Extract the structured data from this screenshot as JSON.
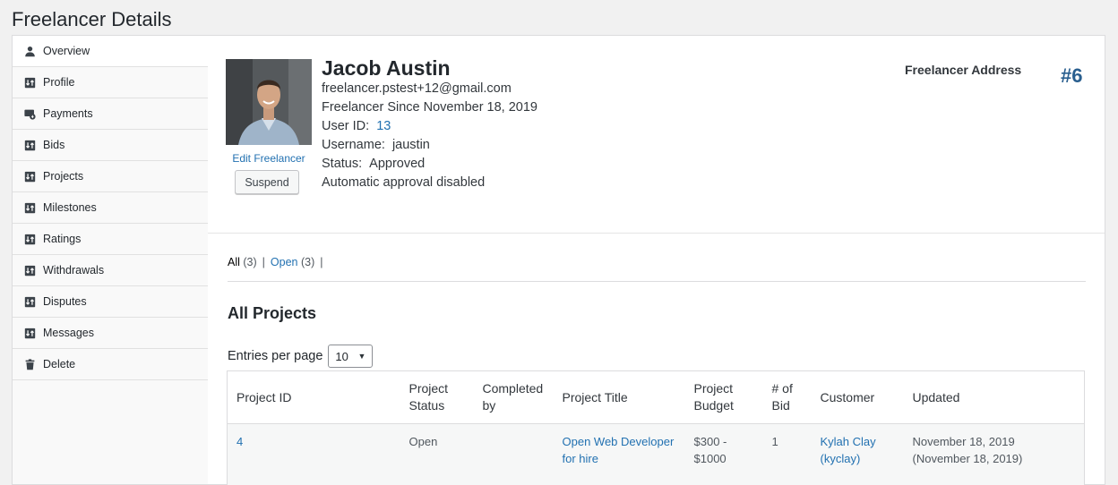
{
  "page": {
    "title": "Freelancer Details"
  },
  "sidebar": {
    "items": [
      {
        "label": "Overview",
        "icon": "user-icon"
      },
      {
        "label": "Profile",
        "icon": "sort-icon"
      },
      {
        "label": "Payments",
        "icon": "payments-icon"
      },
      {
        "label": "Bids",
        "icon": "sort-icon"
      },
      {
        "label": "Projects",
        "icon": "sort-icon"
      },
      {
        "label": "Milestones",
        "icon": "sort-icon"
      },
      {
        "label": "Ratings",
        "icon": "sort-icon"
      },
      {
        "label": "Withdrawals",
        "icon": "sort-icon"
      },
      {
        "label": "Disputes",
        "icon": "sort-icon"
      },
      {
        "label": "Messages",
        "icon": "sort-icon"
      },
      {
        "label": "Delete",
        "icon": "trash-icon"
      }
    ]
  },
  "profile": {
    "name": "Jacob Austin",
    "email": "freelancer.pstest+12@gmail.com",
    "since": "Freelancer Since November 18, 2019",
    "user_id_label": "User ID:",
    "user_id": "13",
    "username_label": "Username:",
    "username": "jaustin",
    "status_label": "Status:",
    "status": "Approved",
    "approval": "Automatic approval disabled",
    "edit_label": "Edit Freelancer",
    "suspend_label": "Suspend",
    "address_label": "Freelancer Address",
    "number": "#6"
  },
  "filters": {
    "all_label": "All",
    "all_count": "(3)",
    "open_label": "Open",
    "open_count": "(3)",
    "sep": "|"
  },
  "projects": {
    "title": "All Projects",
    "entries_label": "Entries per page",
    "entries_value": "10",
    "columns": [
      "Project ID",
      "Project Status",
      "Completed by",
      "Project Title",
      "Project Budget",
      "# of Bid",
      "Customer",
      "Updated"
    ],
    "rows": [
      {
        "id": "4",
        "status": "Open",
        "completed_by": "",
        "title": "Open Web Developer for hire",
        "budget": "$300 - $1000",
        "bids": "1",
        "customer": "Kylah Clay (kyclay)",
        "updated": "November 18, 2019 (November 18, 2019)"
      }
    ]
  }
}
